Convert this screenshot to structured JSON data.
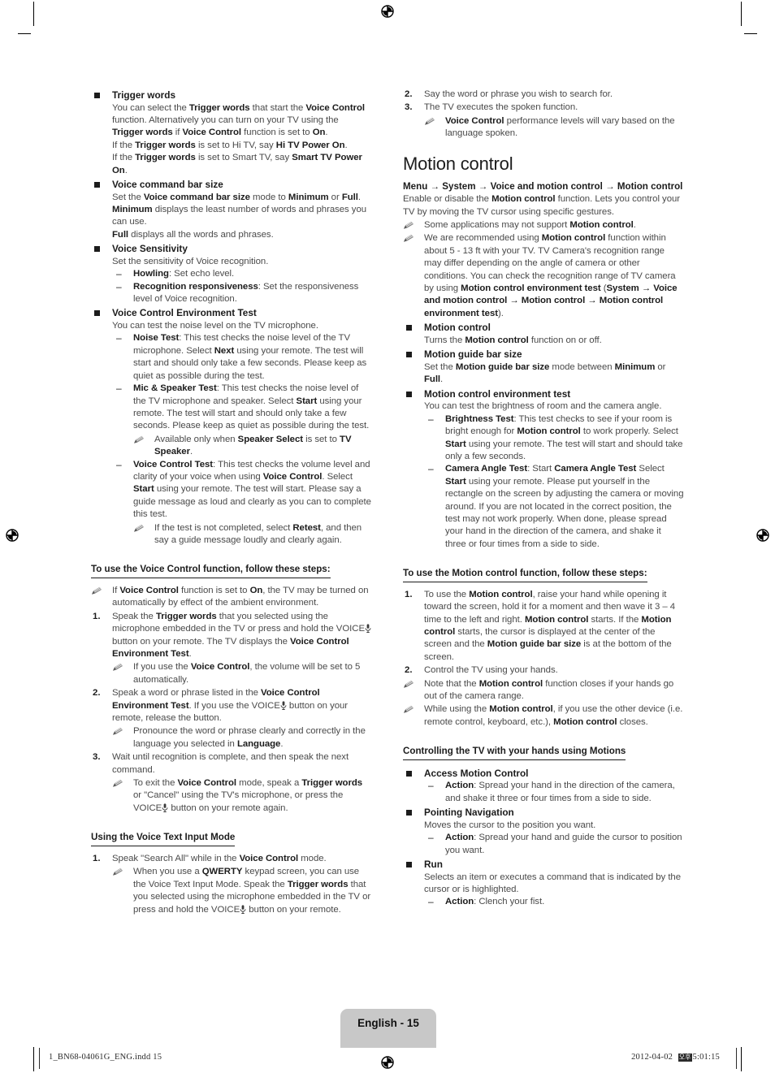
{
  "page": {
    "badge": "English - 15",
    "footer_left": "1_BN68-04061G_ENG.indd   15",
    "footer_date": "2012-04-02",
    "footer_ampm": "오후",
    "footer_time": "5:01:15"
  },
  "left_column": {
    "trigger_words": {
      "title": "Trigger words",
      "p1_a": "You can select the ",
      "p1_b1": "Trigger words",
      "p1_c": " that start the ",
      "p1_b2": "Voice Control",
      "p1_d": " function. Alternatively you can turn on your TV using the ",
      "p1_b3": "Trigger words",
      "p1_e": " if ",
      "p1_b4": "Voice Control",
      "p1_f": " function is set to ",
      "p1_b5": "On",
      "p1_g": ".",
      "p2_a": "If the ",
      "p2_b1": "Trigger words",
      "p2_c": " is set to Hi TV, say ",
      "p2_b2": "Hi TV Power On",
      "p2_d": ".",
      "p3_a": "If the ",
      "p3_b1": "Trigger words",
      "p3_c": " is set to Smart TV, say ",
      "p3_b2": "Smart TV Power On",
      "p3_d": "."
    },
    "voice_command_bar_size": {
      "title": "Voice command bar size",
      "p1_a": "Set the ",
      "p1_b1": "Voice command bar size",
      "p1_c": " mode to ",
      "p1_b2": "Minimum",
      "p1_d": " or ",
      "p1_b3": "Full",
      "p1_e": ".",
      "p2_b1": "Minimum",
      "p2_c": " displays the least number of words and phrases you can use.",
      "p3_b1": "Full",
      "p3_c": " displays all the words and phrases."
    },
    "voice_sensitivity": {
      "title": "Voice Sensitivity",
      "desc": "Set the sensitivity of Voice recognition.",
      "items": [
        {
          "label": "Howling",
          "text": ": Set echo level."
        },
        {
          "label": "Recognition responsiveness",
          "text": ": Set the responsiveness level of Voice recognition."
        }
      ]
    },
    "voice_control_env_test": {
      "title": "Voice Control Environment Test",
      "desc": "You can test the noise level on the TV microphone.",
      "noise_test": {
        "label": "Noise Test",
        "a": ": This test checks the noise level of the TV microphone. Select ",
        "b": "Next",
        "c": " using your remote. The test will start and should only take a few seconds. Please keep as quiet as possible during the test."
      },
      "mic_speaker_test": {
        "label": "Mic & Speaker Test",
        "a": ": This test checks the noise level of the TV microphone and speaker. Select ",
        "b": "Start",
        "c": " using your remote. The test will start and should only take a few seconds. Please keep as quiet as possible during the test.",
        "note_a": "Available only when ",
        "note_b1": "Speaker Select",
        "note_c": " is set to ",
        "note_b2": "TV Speaker",
        "note_d": "."
      },
      "voice_control_test": {
        "label": "Voice Control Test",
        "a": ": This test checks the volume level and clarity of your voice when using ",
        "b1": "Voice Control",
        "c": ". Select ",
        "b2": "Start",
        "d": " using your remote. The test will start. Please say a guide message as loud and clearly as you can to complete this test.",
        "note_a": "If the test is not completed, select ",
        "note_b": "Retest",
        "note_c": ", and then say a guide message loudly and clearly again."
      }
    },
    "voice_steps": {
      "heading": "To use the Voice Control function, follow these steps:",
      "note_a": "If ",
      "note_b1": "Voice Control",
      "note_c": " function is set to ",
      "note_b2": "On",
      "note_d": ", the TV may be turned on automatically by effect of the ambient environment.",
      "step1": {
        "num": "1.",
        "a": "Speak the ",
        "b1": "Trigger words",
        "c": " that you selected using the microphone embedded in the TV or press and hold the VOICE",
        "d": " button on your remote. The TV displays the ",
        "b2": "Voice Control Environment Test",
        "e": ".",
        "note_a": "If you use the ",
        "note_b": "Voice Control",
        "note_c": ", the volume will be set to 5 automatically."
      },
      "step2": {
        "num": "2.",
        "a": "Speak a word or phrase listed in the ",
        "b1": "Voice Control Environment Test",
        "c": ". If you use the VOICE",
        "d": " button on your remote, release the button.",
        "note_a": "Pronounce the word or phrase clearly and correctly in the language you selected in ",
        "note_b": "Language",
        "note_c": "."
      },
      "step3": {
        "num": "3.",
        "a": "Wait until recognition is complete, and then speak the next command.",
        "note_a": "To exit the ",
        "note_b1": "Voice Control",
        "note_c": " mode, speak a ",
        "note_b2": "Trigger words",
        "note_d": " or \"Cancel\" using the TV's microphone, or press the VOICE",
        "note_e": " button on your remote again."
      }
    },
    "voice_text_input": {
      "heading": "Using the Voice Text Input Mode",
      "step1": {
        "num": "1.",
        "a": "Speak \"Search All\" while in the ",
        "b1": "Voice Control",
        "c": " mode.",
        "note_a": "When you use a ",
        "note_b1": "QWERTY",
        "note_c": " keypad screen, you can use the Voice Text Input Mode. Speak the ",
        "note_b2": "Trigger words",
        "note_d": " that you selected using the microphone embedded in the TV or press and hold the VOICE",
        "note_e": " button on your remote."
      }
    }
  },
  "right_column": {
    "voice_steps_cont": {
      "step2": {
        "num": "2.",
        "text": "Say the word or phrase you wish to search for."
      },
      "step3": {
        "num": "3.",
        "text": "The TV executes the spoken function.",
        "note_b": "Voice Control",
        "note_c": " performance levels will vary based on the language spoken."
      }
    },
    "motion_control": {
      "title": "Motion control",
      "menu_path": "Menu → System → Voice and motion control → Motion control",
      "intro_a": "Enable or disable the ",
      "intro_b": "Motion control",
      "intro_c": " function. Lets you control your TV by moving the TV cursor using specific gestures.",
      "note1_a": "Some applications may not support ",
      "note1_b": "Motion control",
      "note1_c": ".",
      "note2_a": "We are recommended using ",
      "note2_b1": "Motion control",
      "note2_c": " function within about 5 - 13 ft with your TV. TV Camera's recognition range may differ depending on the angle of camera or other conditions. You can check the recognition range of TV camera by using ",
      "note2_b2": "Motion control environment test",
      "note2_d": " (",
      "note2_b3": "System → Voice and motion control → Motion control → Motion control environment test",
      "note2_e": ").",
      "items": {
        "motion_control": {
          "title": "Motion control",
          "a": "Turns the ",
          "b": "Motion control",
          "c": " function on or off."
        },
        "motion_guide_bar_size": {
          "title": "Motion guide bar size",
          "a": "Set the ",
          "b1": "Motion guide bar size",
          "c": " mode between ",
          "b2": "Minimum",
          "d": " or ",
          "b3": "Full",
          "e": "."
        },
        "motion_env_test": {
          "title": "Motion control environment test",
          "desc": "You can test the brightness of room and the camera angle.",
          "brightness_test": {
            "label": "Brightness Test",
            "a": ": This test checks to see if your room is bright enough for ",
            "b1": "Motion control",
            "c": " to work properly. Select ",
            "b2": "Start",
            "d": " using your remote. The test will start and should take only a few seconds."
          },
          "camera_angle_test": {
            "label": "Camera Angle Test",
            "a": ": Start ",
            "b1": "Camera Angle Test",
            "c": " Select ",
            "b2": "Start",
            "d": " using your remote. Please put yourself in the rectangle on the screen by adjusting the camera or moving around. If you are not located in the correct position, the test may not work properly. When done, please spread your hand in the direction of the camera, and shake it three or four times from a side to side."
          }
        }
      }
    },
    "motion_steps": {
      "heading": "To use the Motion control function, follow these steps:",
      "step1": {
        "num": "1.",
        "a": "To use the ",
        "b1": "Motion control",
        "c": ", raise your hand while opening it toward the screen, hold it for a moment and then wave it 3 – 4 time to the left and right. ",
        "b2": "Motion control",
        "d": " starts. If the ",
        "b3": "Motion control",
        "e": " starts, the cursor is displayed at the center of the screen and the ",
        "b4": "Motion guide bar size",
        "f": " is at the bottom of the screen."
      },
      "step2": {
        "num": "2.",
        "text": "Control the TV using your hands."
      },
      "note1_a": "Note that the ",
      "note1_b": "Motion control",
      "note1_c": " function closes if your hands go out of the camera range.",
      "note2_a": "While using the ",
      "note2_b1": "Motion control",
      "note2_c": ", if you use the other device (i.e. remote control, keyboard, etc.), ",
      "note2_b2": "Motion control",
      "note2_d": " closes."
    },
    "motions": {
      "heading": "Controlling the TV with your hands using Motions",
      "access": {
        "title": "Access Motion Control",
        "action_label": "Action",
        "action_text": ": Spread your hand in the direction of the camera, and shake it three or four times from a side to side."
      },
      "pointing": {
        "title": "Pointing Navigation",
        "desc": "Moves the cursor to the position you want.",
        "action_label": "Action",
        "action_text": ": Spread your hand and guide the cursor to position you want."
      },
      "run": {
        "title": "Run",
        "desc": "Selects an item or executes a command that is indicated by the cursor or is highlighted.",
        "action_label": "Action",
        "action_text": ": Clench your fist."
      }
    }
  }
}
